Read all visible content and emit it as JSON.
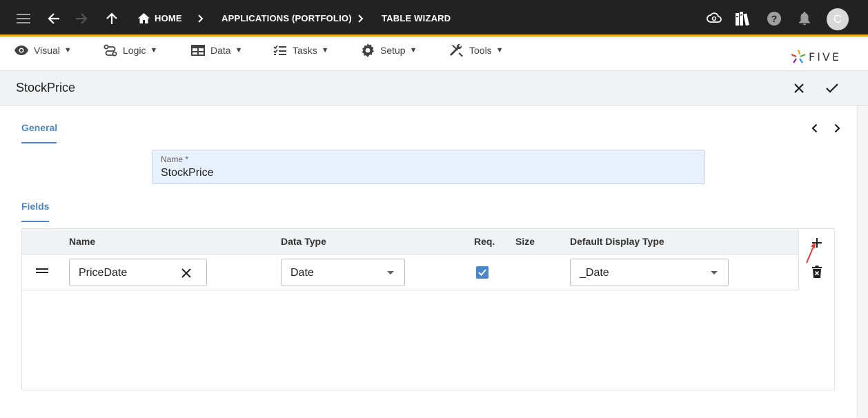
{
  "topbar": {
    "breadcrumbs": [
      "HOME",
      "APPLICATIONS (PORTFOLIO)",
      "TABLE WIZARD"
    ],
    "avatar_initial": "C",
    "accent_color": "#f0a81a"
  },
  "menubar": {
    "items": [
      {
        "label": "Visual",
        "icon": "eye-icon"
      },
      {
        "label": "Logic",
        "icon": "logic-flow-icon"
      },
      {
        "label": "Data",
        "icon": "table-grid-icon"
      },
      {
        "label": "Tasks",
        "icon": "checklist-icon"
      },
      {
        "label": "Setup",
        "icon": "gear-icon"
      },
      {
        "label": "Tools",
        "icon": "wrench-screwdriver-icon"
      }
    ],
    "logo_text": "FIVE"
  },
  "form": {
    "title": "StockPrice",
    "general_tab": "General",
    "name_field": {
      "label": "Name *",
      "value": "StockPrice"
    },
    "fields_section": "Fields",
    "table": {
      "headers": [
        "Name",
        "Data Type",
        "Req.",
        "Size",
        "Default Display Type"
      ],
      "rows": [
        {
          "name": "PriceDate",
          "data_type": "Date",
          "required": true,
          "size": "",
          "display_type": "_Date"
        }
      ]
    }
  },
  "colors": {
    "primary": "#4a86c8",
    "topbar": "#222222",
    "annotation": "#e53935"
  }
}
